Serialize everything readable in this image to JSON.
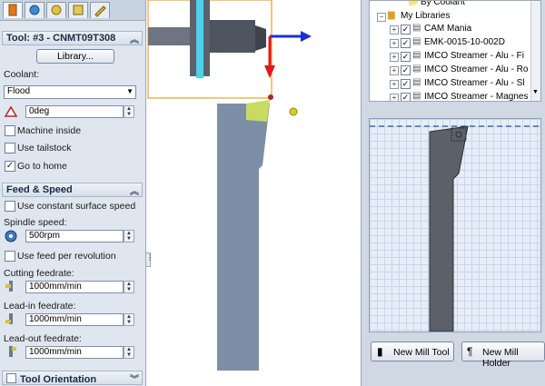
{
  "tabs": [
    "tool-tab",
    "setup-tab",
    "holder-tab",
    "data-tab",
    "edit-tab"
  ],
  "tool_section": {
    "title": "Tool: #3 - CNMT09T308",
    "library_button": "Library...",
    "coolant_label": "Coolant:",
    "coolant_value": "Flood",
    "angle_value": "0deg",
    "machine_inside": "Machine inside",
    "use_tailstock": "Use tailstock",
    "go_to_home": "Go to home"
  },
  "feed_section": {
    "title": "Feed & Speed",
    "constant_surface_speed": "Use constant surface speed",
    "spindle_label": "Spindle speed:",
    "spindle_value": "500rpm",
    "feed_per_rev": "Use feed per revolution",
    "cutting_label": "Cutting feedrate:",
    "cutting_value": "1000mm/min",
    "leadin_label": "Lead-in feedrate:",
    "leadin_value": "1000mm/min",
    "leadout_label": "Lead-out feedrate:",
    "leadout_value": "1000mm/min"
  },
  "orientation_section": {
    "title": "Tool Orientation"
  },
  "library_tree": {
    "by_coolant": "By Coolant",
    "my_libraries": "My Libraries",
    "items": [
      "CAM Mania",
      "EMK-0015-10-002D",
      "IMCO Streamer - Alu - Fi",
      "IMCO Streamer - Alu - Ro",
      "IMCO Streamer - Alu - Sl",
      "IMCO Streamer - Magnes"
    ]
  },
  "bottom_buttons": {
    "new_mill_tool": "New Mill Tool",
    "new_mill_holder": "New Mill Holder"
  },
  "colors": {
    "panel_bg": "#dfe6ef",
    "tool_body": "#7d8fa6",
    "insert": "#c7dc5e",
    "axis_x": "#1c2ee0",
    "axis_y": "#e01818",
    "bbox": "#f0a020"
  }
}
